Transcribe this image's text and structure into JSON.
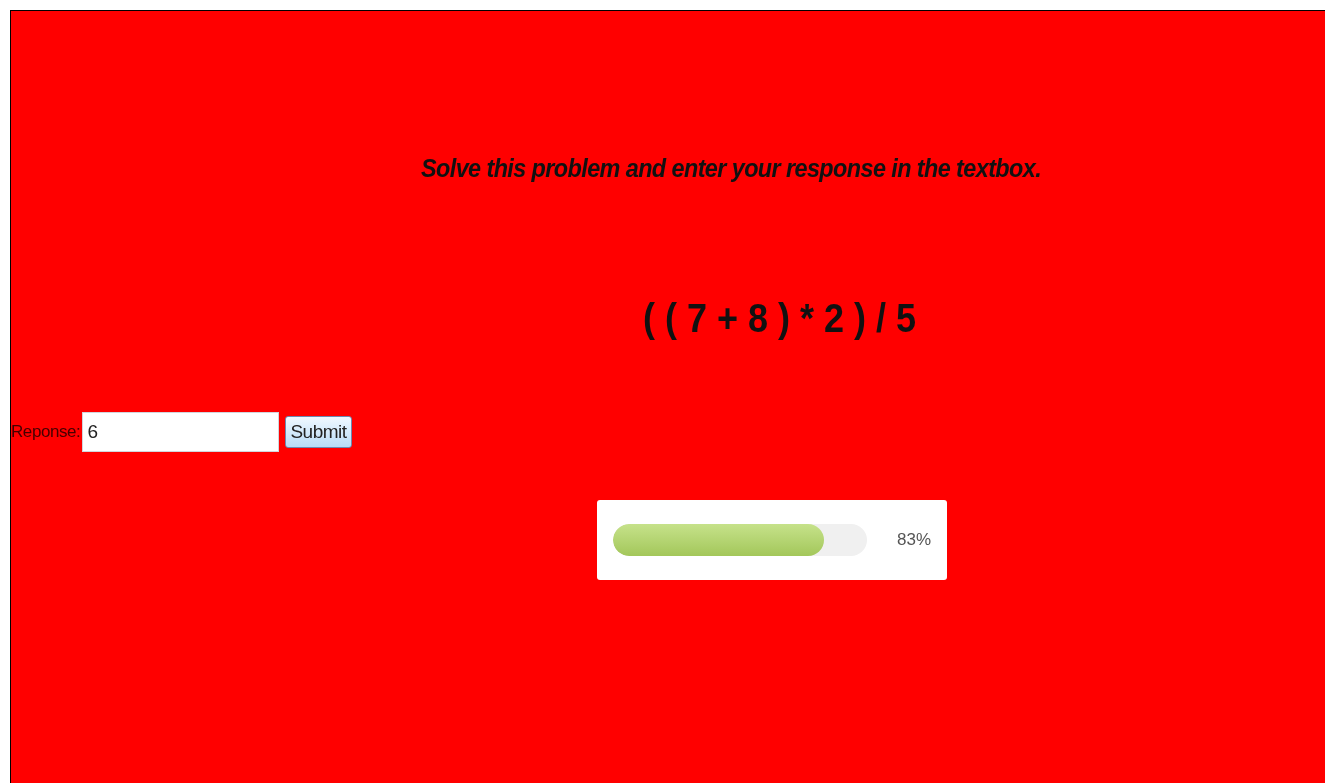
{
  "instruction": "Solve this problem and enter your response in the textbox.",
  "problem": "( ( 7 + 8 ) * 2 ) / 5",
  "response": {
    "label": "Reponse:",
    "value": "6",
    "button": "Submit"
  },
  "progress": {
    "level": 0.83,
    "reading": "83%"
  }
}
